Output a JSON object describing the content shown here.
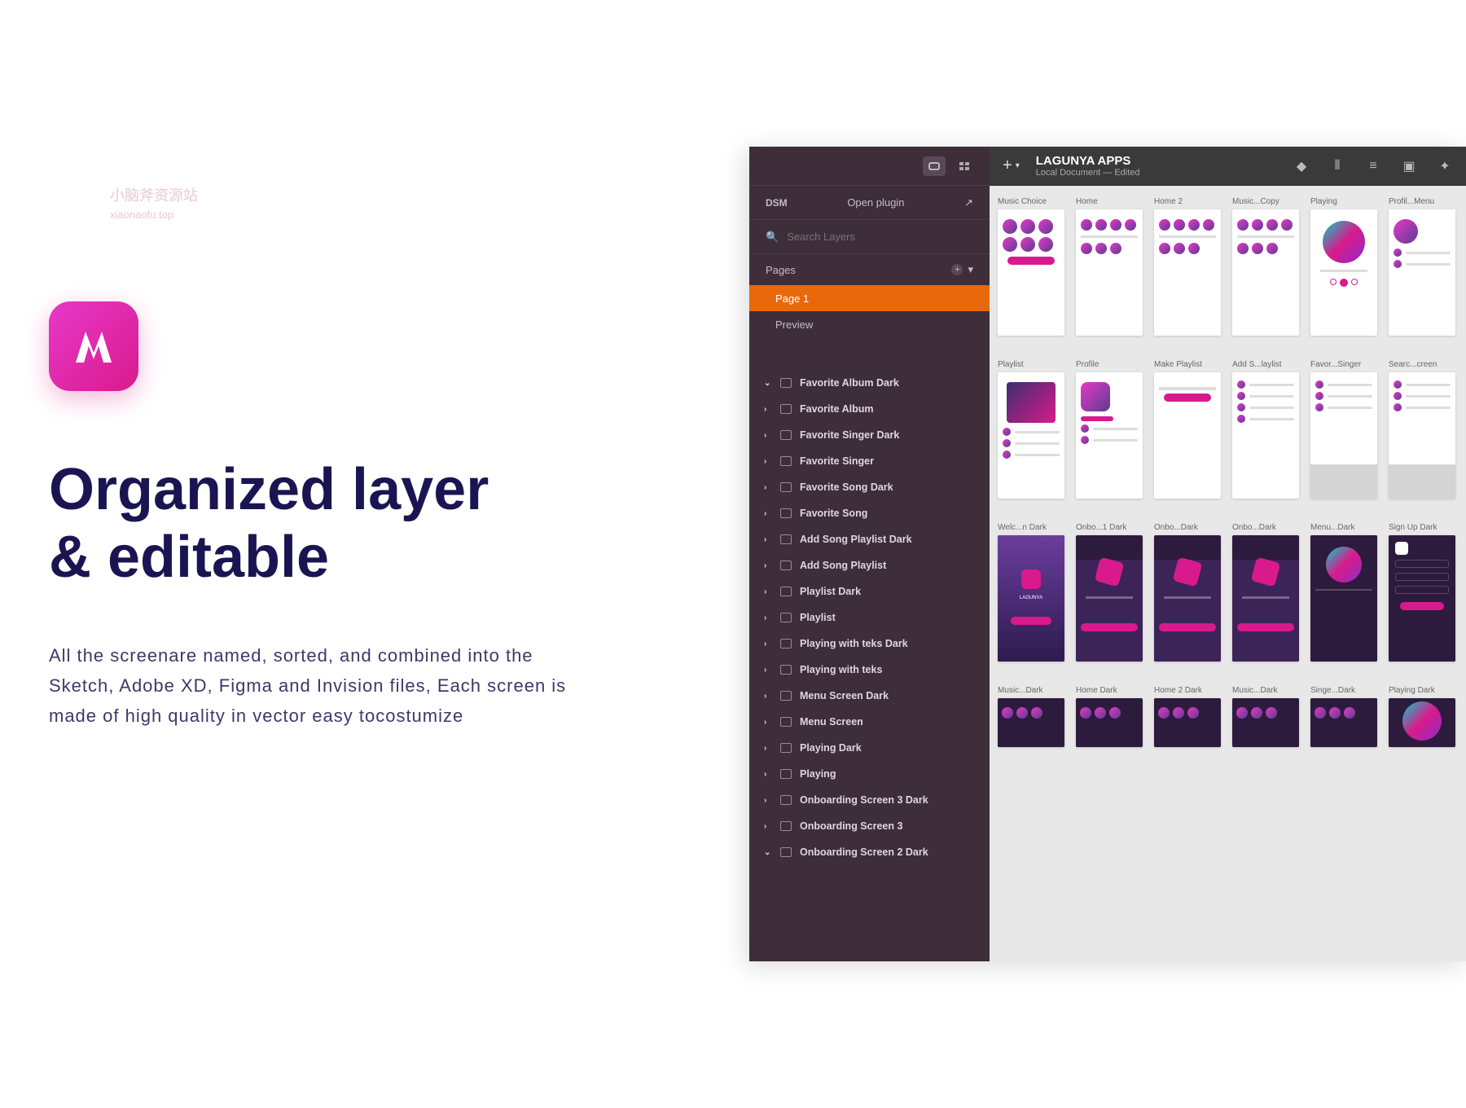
{
  "left": {
    "heading_line1": "Organized layer",
    "heading_line2": "& editable",
    "description": "All the screenare named, sorted, and combined into the Sketch, Adobe XD, Figma and Invision files, Each screen is made of high quality in vector easy tocostumize"
  },
  "editor": {
    "plugin_label": "DSM",
    "plugin_action": "Open plugin",
    "search_placeholder": "Search Layers",
    "pages_label": "Pages",
    "pages": [
      "Page 1",
      "Preview"
    ],
    "doc_title": "LAGUNYA APPS",
    "doc_subtitle": "Local Document — Edited",
    "layers": [
      "Favorite Album Dark",
      "Favorite Album",
      "Favorite Singer Dark",
      "Favorite Singer",
      "Favorite Song Dark",
      "Favorite Song",
      "Add Song Playlist Dark",
      "Add Song Playlist",
      "Playlist Dark",
      "Playlist",
      "Playing with teks Dark",
      "Playing with teks",
      "Menu Screen Dark",
      "Menu Screen",
      "Playing Dark",
      "Playing",
      "Onboarding Screen 3 Dark",
      "Onboarding Screen 3",
      "Onboarding Screen 2 Dark"
    ],
    "artboard_rows": [
      [
        "Music Choice",
        "Home",
        "Home 2",
        "Music...Copy",
        "Playing",
        "Profil...Menu"
      ],
      [
        "Playlist",
        "Profile",
        "Make Playlist",
        "Add S...laylist",
        "Favor...Singer",
        "Searc...creen"
      ],
      [
        "Welc...n Dark",
        "Onbo...1 Dark",
        "Onbo...Dark",
        "Onbo...Dark",
        "Menu...Dark",
        "Sign Up Dark"
      ],
      [
        "Music...Dark",
        "Home Dark",
        "Home 2 Dark",
        "Music...Dark",
        "Singe...Dark",
        "Playing Dark"
      ]
    ]
  },
  "watermark": {
    "main": "小脑斧资源站",
    "sub": "xiaonaofu.top"
  }
}
